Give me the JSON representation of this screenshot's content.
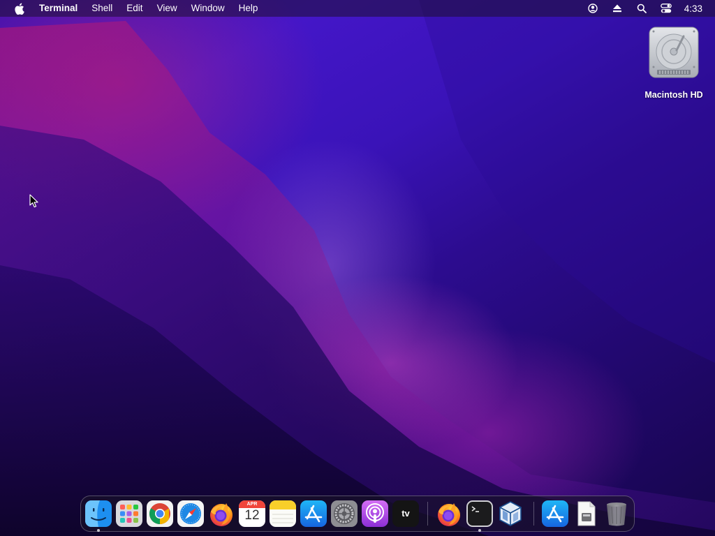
{
  "menubar": {
    "app_name": "Terminal",
    "items": [
      "Shell",
      "Edit",
      "View",
      "Window",
      "Help"
    ],
    "clock": "4:33",
    "status_icons": [
      "user-icon",
      "eject-icon",
      "search-icon",
      "control-center-icon"
    ]
  },
  "desktop": {
    "icons": [
      {
        "label": "Macintosh HD",
        "icon": "hard-drive-icon"
      }
    ]
  },
  "dock": {
    "apps": [
      {
        "name": "finder",
        "running": true
      },
      {
        "name": "launchpad",
        "running": false
      },
      {
        "name": "chrome",
        "running": false
      },
      {
        "name": "safari",
        "running": false
      },
      {
        "name": "firefox",
        "running": false
      },
      {
        "name": "calendar",
        "running": false,
        "month": "APR",
        "day": "12"
      },
      {
        "name": "notes",
        "running": false
      },
      {
        "name": "app-store",
        "running": false
      },
      {
        "name": "system-preferences",
        "running": false
      },
      {
        "name": "podcasts",
        "running": false
      },
      {
        "name": "apple-tv",
        "running": false,
        "label": "tv"
      },
      {
        "name": "firefox-recent",
        "running": false
      },
      {
        "name": "terminal",
        "running": true
      },
      {
        "name": "virtualbox",
        "running": false
      },
      {
        "name": "app-store-folder",
        "running": false
      },
      {
        "name": "document-stack",
        "running": false
      },
      {
        "name": "trash",
        "running": false
      }
    ]
  },
  "colors": {
    "wallpaper_dark": "#16054a",
    "wallpaper_blue": "#4416c8",
    "wallpaper_magenta": "#c828b4"
  }
}
